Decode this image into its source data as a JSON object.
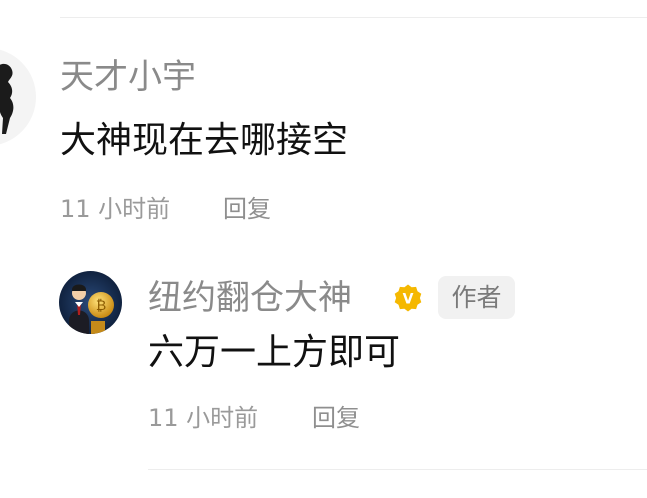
{
  "comment": {
    "username": "天才小宇",
    "text": "大神现在去哪接空",
    "time": "11 小时前",
    "reply_label": "回复"
  },
  "reply": {
    "username": "纽约翻仓大神",
    "verified_badge_letter": "V",
    "author_tag": "作者",
    "text": "六万一上方即可",
    "time": "11 小时前",
    "reply_label": "回复"
  },
  "colors": {
    "username": "#8a8a8a",
    "text": "#111111",
    "meta": "#9a9a9a",
    "badge": "#f5b800",
    "author_tag_bg": "#f1f1f1"
  }
}
